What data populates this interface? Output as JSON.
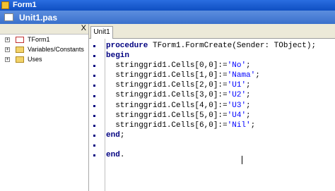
{
  "window": {
    "title": "Form1"
  },
  "editor": {
    "title": "Unit1.pas"
  },
  "explorer": {
    "close_label": "X",
    "items": [
      {
        "label": "TForm1",
        "expander": "+",
        "icon": "form-icon"
      },
      {
        "label": "Variables/Constants",
        "expander": "+",
        "icon": "folder-icon"
      },
      {
        "label": "Uses",
        "expander": "+",
        "icon": "folder-icon"
      }
    ]
  },
  "tabs": [
    {
      "label": "Unit1"
    }
  ],
  "code": {
    "lines": [
      {
        "parts": [
          {
            "t": "procedure",
            "k": "kw"
          },
          {
            "t": " TForm1.FormCreate(Sender: TObject);"
          }
        ]
      },
      {
        "parts": [
          {
            "t": "begin",
            "k": "kw"
          }
        ]
      },
      {
        "parts": [
          {
            "t": "  stringgrid1.Cells[0,0]:="
          },
          {
            "t": "'No'",
            "k": "str"
          },
          {
            "t": ";"
          }
        ]
      },
      {
        "parts": [
          {
            "t": "  stringgrid1.Cells[1,0]:="
          },
          {
            "t": "'Nama'",
            "k": "str"
          },
          {
            "t": ";"
          }
        ]
      },
      {
        "parts": [
          {
            "t": "  stringgrid1.Cells[2,0]:="
          },
          {
            "t": "'U1'",
            "k": "str"
          },
          {
            "t": ";"
          }
        ]
      },
      {
        "parts": [
          {
            "t": "  stringgrid1.Cells[3,0]:="
          },
          {
            "t": "'U2'",
            "k": "str"
          },
          {
            "t": ";"
          }
        ]
      },
      {
        "parts": [
          {
            "t": "  stringgrid1.Cells[4,0]:="
          },
          {
            "t": "'U3'",
            "k": "str"
          },
          {
            "t": ";"
          }
        ]
      },
      {
        "parts": [
          {
            "t": "  stringgrid1.Cells[5,0]:="
          },
          {
            "t": "'U4'",
            "k": "str"
          },
          {
            "t": ";"
          }
        ]
      },
      {
        "parts": [
          {
            "t": "  stringgrid1.Cells[6,0]:="
          },
          {
            "t": "'Nil'",
            "k": "str"
          },
          {
            "t": ";"
          }
        ]
      },
      {
        "parts": [
          {
            "t": "end",
            "k": "kw"
          },
          {
            "t": ";"
          }
        ]
      },
      {
        "parts": [
          {
            "t": ""
          }
        ]
      },
      {
        "parts": [
          {
            "t": "end",
            "k": "kw"
          },
          {
            "t": "."
          }
        ]
      }
    ]
  },
  "colors": {
    "titlebar": "#1f5fd0",
    "keyword": "#000080",
    "string": "#0000ff"
  }
}
